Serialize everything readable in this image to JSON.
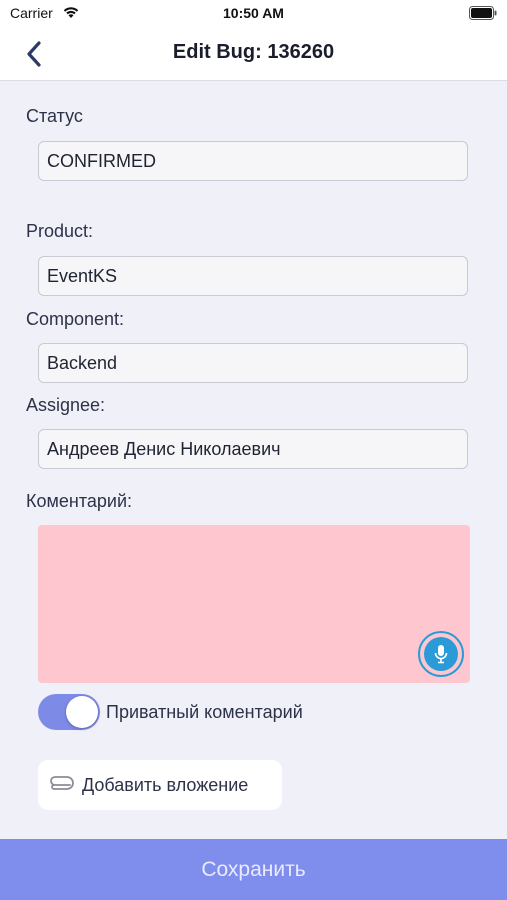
{
  "status_bar": {
    "carrier": "Carrier",
    "time": "10:50 AM"
  },
  "nav": {
    "title": "Edit Bug: 136260",
    "back_icon": "chevron-left-icon"
  },
  "form": {
    "status": {
      "label": "Статус",
      "value": "CONFIRMED"
    },
    "product": {
      "label": "Product:",
      "value": "EventKS"
    },
    "component": {
      "label": "Component:",
      "value": "Backend"
    },
    "assignee": {
      "label": "Assignee:",
      "value": "Андреев Денис Николаевич"
    },
    "comment": {
      "label": "Коментарий:",
      "value": ""
    },
    "private_toggle": {
      "label": "Приватный коментарий",
      "on": true
    },
    "attach": {
      "label": "Добавить вложение",
      "icon": "paperclip-icon"
    }
  },
  "save_label": "Сохранить",
  "colors": {
    "background": "#eff0f8",
    "accent": "#7f8ded",
    "comment_bg": "#fec7cf",
    "mic": "#2a9bd6"
  }
}
